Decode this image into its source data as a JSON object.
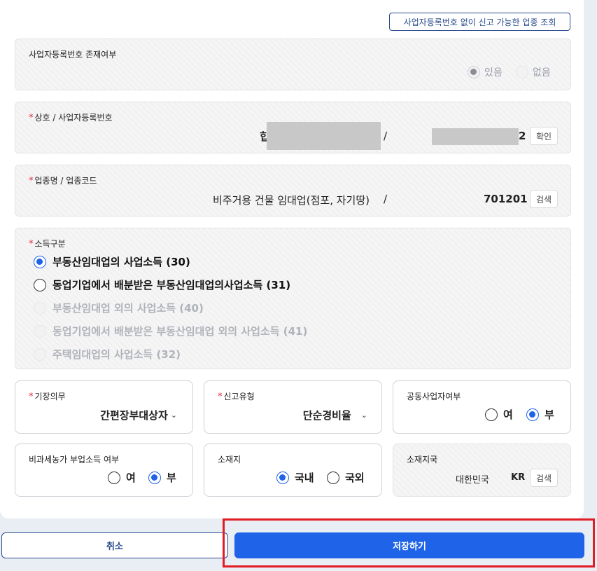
{
  "lookup_button": "사업자등록번호 없이 신고 가능한 업종 조회",
  "biz_reg_existence": {
    "label": "사업자등록번호 존재여부",
    "options": [
      "있음",
      "없음"
    ],
    "selected": "있음"
  },
  "trade_name": {
    "required_mark": "*",
    "label": "상호 / 사업자등록번호",
    "name_partial": "힙",
    "separator": "/",
    "reg_no_partial": "2",
    "confirm_label": "확인"
  },
  "industry": {
    "required_mark": "*",
    "label": "업종명 / 업종코드",
    "name": "비주거용 건물 임대업(점포, 자기땅)",
    "separator": "/",
    "code": "701201",
    "search_label": "검색"
  },
  "income_type": {
    "required_mark": "*",
    "label": "소득구분",
    "options": [
      "부동산임대업의 사업소득 (30)",
      "동업기업에서 배분받은 부동산임대업의사업소득 (31)",
      "부동산임대업 외의 사업소득 (40)",
      "동업기업에서 배분받은 부동산임대업 외의 사업소득 (41)",
      "주택임대업의 사업소득 (32)"
    ],
    "selected": "부동산임대업의 사업소득 (30)"
  },
  "bookkeeping": {
    "required_mark": "*",
    "label": "기장의무",
    "value": "간편장부대상자"
  },
  "filing_type": {
    "required_mark": "*",
    "label": "신고유형",
    "value": "단순경비율"
  },
  "joint_business": {
    "label": "공동사업자여부",
    "yes": "여",
    "no": "부",
    "selected": "부"
  },
  "farm_income": {
    "label": "비과세농가 부업소득 여부",
    "yes": "여",
    "no": "부",
    "selected": "부"
  },
  "location": {
    "label": "소재지",
    "domestic": "국내",
    "foreign": "국외",
    "selected": "국내"
  },
  "country": {
    "label": "소재지국",
    "name": "대한민국",
    "code": "KR",
    "search_label": "검색"
  },
  "footer": {
    "cancel_label": "취소",
    "save_label": "저장하기"
  },
  "colors": {
    "primary": "#1f63e8",
    "required": "#e0283c",
    "outline": "#2a4b8d",
    "highlight": "#e31b23"
  }
}
